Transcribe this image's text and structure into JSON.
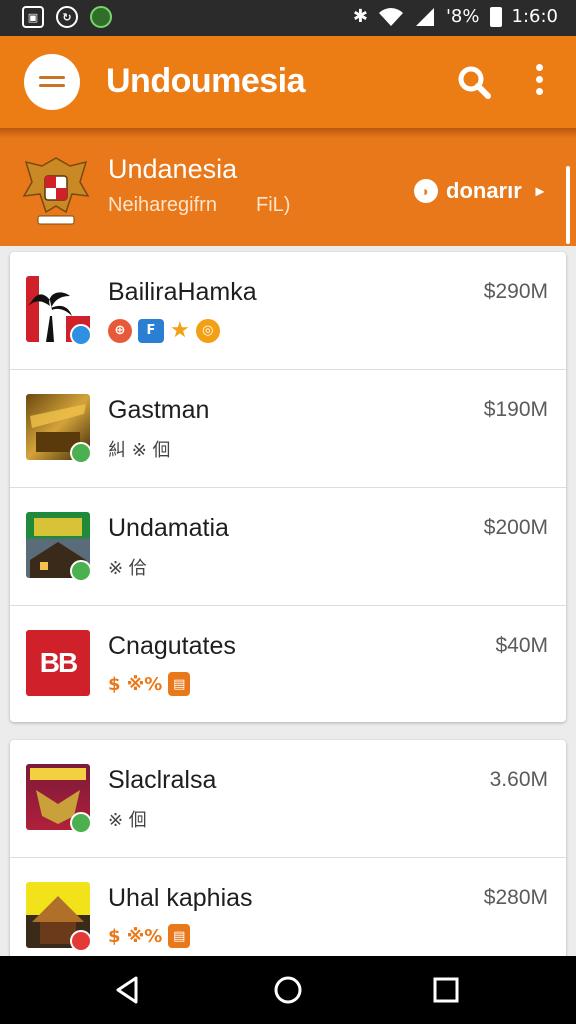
{
  "status_bar": {
    "battery": "'8%",
    "time": "1:6:0",
    "icons": [
      "image-icon",
      "sync-icon",
      "chrome-icon",
      "bluetooth-icon",
      "wifi-icon",
      "signal-icon",
      "battery-icon"
    ]
  },
  "app_bar": {
    "title": "Undoumesia",
    "icons": [
      "menu-icon",
      "search-icon",
      "more-vert-icon"
    ]
  },
  "banner": {
    "title": "Undanesia",
    "subtitle": "Neiharegifrn",
    "subtitle_right": "FiL)",
    "action_label": "donarır",
    "icons": [
      "emblem-icon",
      "donate-icon",
      "chevron-right-icon"
    ]
  },
  "list": {
    "items": [
      {
        "title": "BailiraHamka",
        "price": "$290M",
        "tags": [
          "F"
        ],
        "tag_text": ""
      },
      {
        "title": "Gastman",
        "price": "$190M",
        "tags": [],
        "tag_text": "糾 ※ 佪"
      },
      {
        "title": "Undamatia",
        "price": "$200M",
        "tags": [],
        "tag_text": "※ 佮"
      },
      {
        "title": "Cnagutates",
        "price": "$40M",
        "tags": [],
        "tag_text": "$ ※%"
      },
      {
        "title": "Slaclralsa",
        "price": "3.60M",
        "tags": [],
        "tag_text": "※ 佪"
      },
      {
        "title": "Uhal kaphias",
        "price": "$280M",
        "tags": [],
        "tag_text": "$ ※%"
      }
    ],
    "thumb_labels": {
      "item4": "BB"
    }
  },
  "colors": {
    "accent": "#ec7c14",
    "banner": "#e8781a",
    "badge_green": "#4caf50",
    "badge_blue": "#2f8fe0",
    "red_logo": "#d0202a"
  },
  "nav_bar": {
    "icons": [
      "back-icon",
      "home-icon",
      "recents-icon"
    ]
  }
}
